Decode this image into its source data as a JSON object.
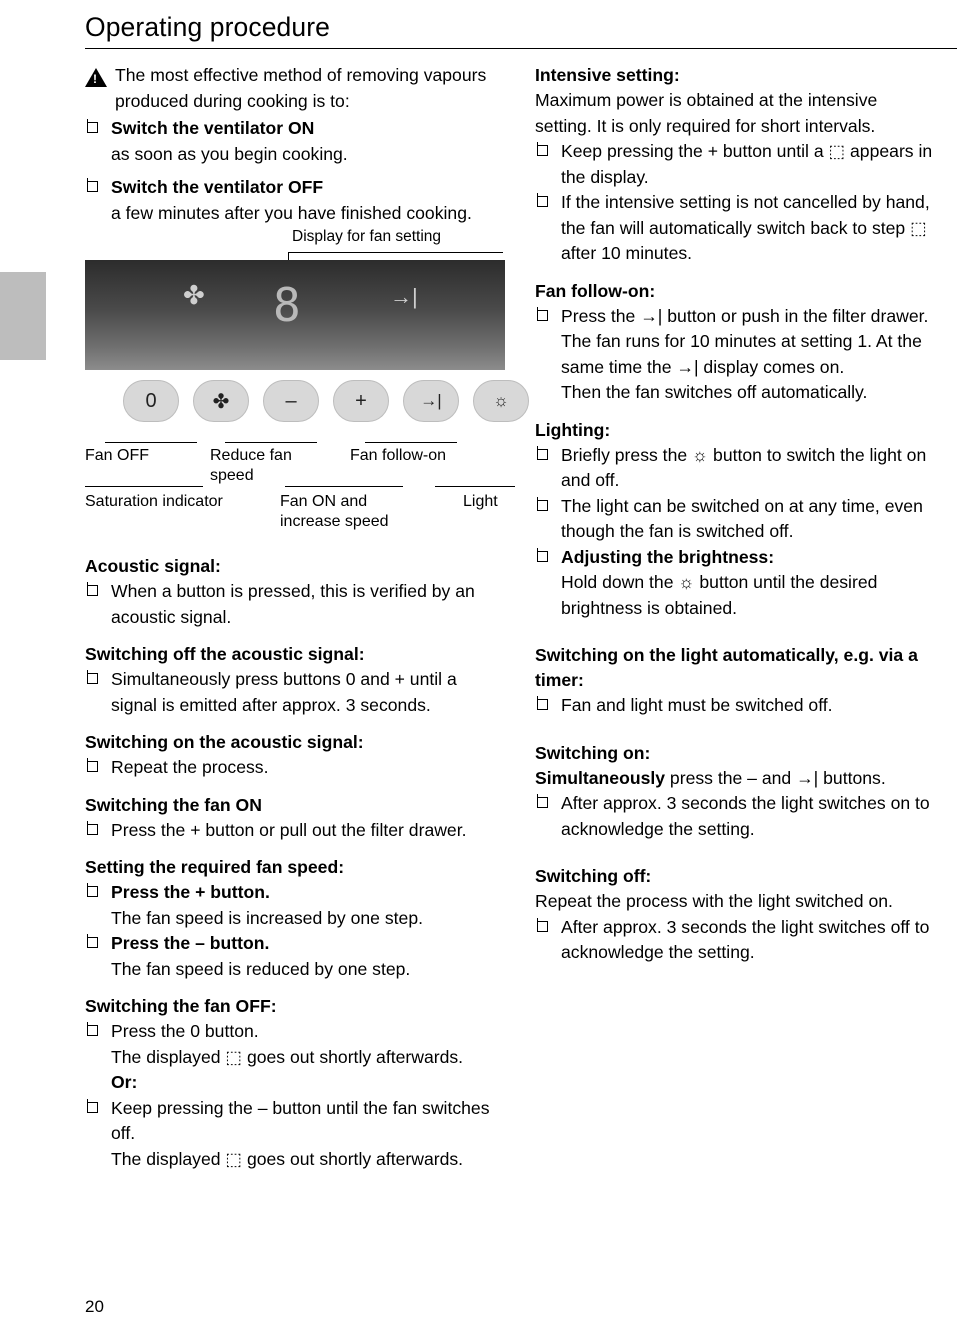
{
  "page": {
    "title": "Operating procedure",
    "number": "20"
  },
  "left": {
    "warning": {
      "icon": "warning-triangle-icon",
      "text": "The most effective method of removing vapours produced during cooking is to:"
    },
    "warning_items": [
      {
        "bold": "Switch the ventilator ON",
        "rest": "as soon as you begin cooking."
      },
      {
        "bold": "Switch the ventilator OFF",
        "rest": "a few minutes after you have finished cooking."
      }
    ],
    "panel": {
      "display_label": "Display for fan setting",
      "display_value": "8",
      "display_icons": [
        "saturation-indicator-icon",
        "fan-follow-on-icon"
      ],
      "buttons": [
        {
          "name": "fan-off-button",
          "glyph": "0"
        },
        {
          "name": "saturation-indicator-button",
          "glyph": "✤"
        },
        {
          "name": "reduce-fan-speed-button",
          "glyph": "–"
        },
        {
          "name": "increase-fan-speed-button",
          "glyph": "+"
        },
        {
          "name": "fan-follow-on-button",
          "glyph": "→|"
        },
        {
          "name": "light-button",
          "glyph": "☼"
        }
      ],
      "captions": {
        "fan_off": "Fan OFF",
        "reduce": "Reduce fan speed",
        "follow_on": "Fan follow-on",
        "saturation": "Saturation indicator",
        "fan_on": "Fan ON and increase speed",
        "light": "Light"
      }
    },
    "sections": [
      {
        "heading": "Acoustic signal:",
        "items": [
          {
            "text": "When a button is pressed, this is verified by an acoustic signal."
          }
        ]
      },
      {
        "heading": "Switching off the acoustic signal:",
        "items": [
          {
            "text": "Simultaneously press buttons 0 and + until a signal is emitted after approx. 3 seconds."
          }
        ]
      },
      {
        "heading": "Switching on the acoustic signal:",
        "items": [
          {
            "text": "Repeat the process."
          }
        ]
      },
      {
        "heading": "Switching the fan ON",
        "items": [
          {
            "text": "Press the + button or pull out the filter drawer."
          }
        ]
      },
      {
        "heading": "Setting the required fan speed:",
        "items": [
          {
            "text": "Press the + button.",
            "sub": "The fan speed is increased by one step."
          },
          {
            "text": "Press the – button.",
            "sub": "The fan speed is reduced by one step."
          }
        ]
      },
      {
        "heading": "Switching the fan OFF:",
        "items": [
          {
            "text": "Press the 0 button.",
            "sub": "The displayed ⬚ goes out shortly afterwards."
          }
        ],
        "or_label": "Or:",
        "after_or": [
          {
            "text": "Keep pressing the – button until the fan switches off.",
            "sub": "The displayed ⬚ goes out shortly afterwards."
          }
        ]
      }
    ]
  },
  "right": {
    "sections": [
      {
        "heading": "Intensive setting:",
        "intro": "Maximum power is obtained at the intensive setting. It is only required for short intervals.",
        "items": [
          {
            "text": "Keep pressing the + button until a ⬚ appears in the display."
          },
          {
            "text": "If the intensive setting is not cancelled by hand, the fan will automatically switch back to step ⬚ after 10 minutes."
          }
        ]
      },
      {
        "heading": "Fan follow-on:",
        "items": [
          {
            "text": "Press the →| button or push in the filter drawer.",
            "sub": "The fan runs for 10 minutes at setting 1. At the same time the →| display comes on.\nThen the fan switches off automatically."
          }
        ]
      },
      {
        "heading": "Lighting:",
        "items": [
          {
            "text": "Briefly press the ☼ button to switch the light on and off."
          },
          {
            "text": "The light can be switched on at any time, even though the fan is switched off."
          },
          {
            "bold": "Adjusting the brightness:",
            "sub": "Hold down the ☼ button until the desired brightness is obtained."
          }
        ]
      },
      {
        "heading": "Switching on the light automatically, e.g. via a timer:",
        "items": [
          {
            "text": "Fan and light must be switched off."
          }
        ]
      },
      {
        "heading": "Switching on:",
        "intro_bold": "Simultaneously",
        "intro_rest": " press the – and →| buttons.",
        "items": [
          {
            "text": "After approx. 3 seconds the light switches on to acknowledge the setting."
          }
        ]
      },
      {
        "heading": "Switching off:",
        "intro": "Repeat the process with the light switched on.",
        "items": [
          {
            "text": "After approx. 3 seconds the light switches off to acknowledge the setting."
          }
        ]
      }
    ]
  }
}
